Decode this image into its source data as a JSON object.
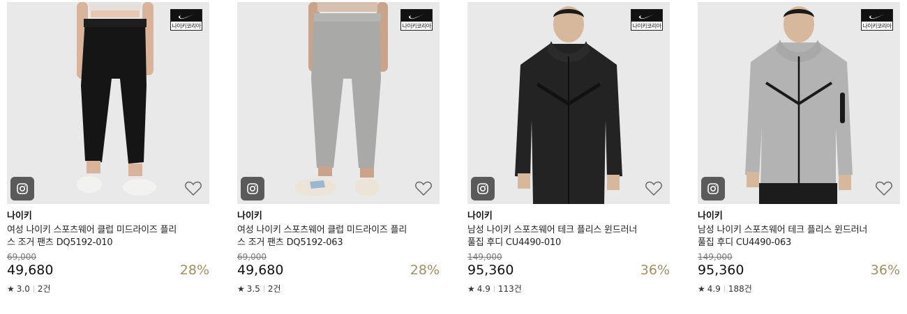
{
  "products": [
    {
      "brand_badge": "나이키코리아",
      "brand": "나이키",
      "name_line1": "여성 나이키 스포츠웨어 클럽 미드라이즈 플리",
      "name_line2": "스 조거 팬츠 DQ5192-010",
      "original_price": "69,000",
      "price": "49,680",
      "discount": "28%",
      "rating": "3.0",
      "reviews": "2건",
      "garment": "black-pants"
    },
    {
      "brand_badge": "나이키코리아",
      "brand": "나이키",
      "name_line1": "여성 나이키 스포츠웨어 클럽 미드라이즈 플리",
      "name_line2": "스 조거 팬츠 DQ5192-063",
      "original_price": "69,000",
      "price": "49,680",
      "discount": "28%",
      "rating": "3.5",
      "reviews": "2건",
      "garment": "grey-pants"
    },
    {
      "brand_badge": "나이키코리아",
      "brand": "나이키",
      "name_line1": "남성 나이키 스포츠웨어 테크 플리스 윈드러너",
      "name_line2": "풀집 후디 CU4490-010",
      "original_price": "149,000",
      "price": "95,360",
      "discount": "36%",
      "rating": "4.9",
      "reviews": "113건",
      "garment": "black-hoodie"
    },
    {
      "brand_badge": "나이키코리아",
      "brand": "나이키",
      "name_line1": "남성 나이키 스포츠웨어 테크 플리스 윈드러너",
      "name_line2": "풀집 후디 CU4490-063",
      "original_price": "149,000",
      "price": "95,360",
      "discount": "36%",
      "rating": "4.9",
      "reviews": "188건",
      "garment": "grey-hoodie"
    }
  ],
  "colors": {
    "discount": "#a08f64",
    "image_bg": "#e9e9e9",
    "instagram_bg": "#5a5a5a"
  },
  "icons": [
    "nike-swoosh-icon",
    "instagram-icon",
    "heart-icon",
    "star-icon"
  ]
}
